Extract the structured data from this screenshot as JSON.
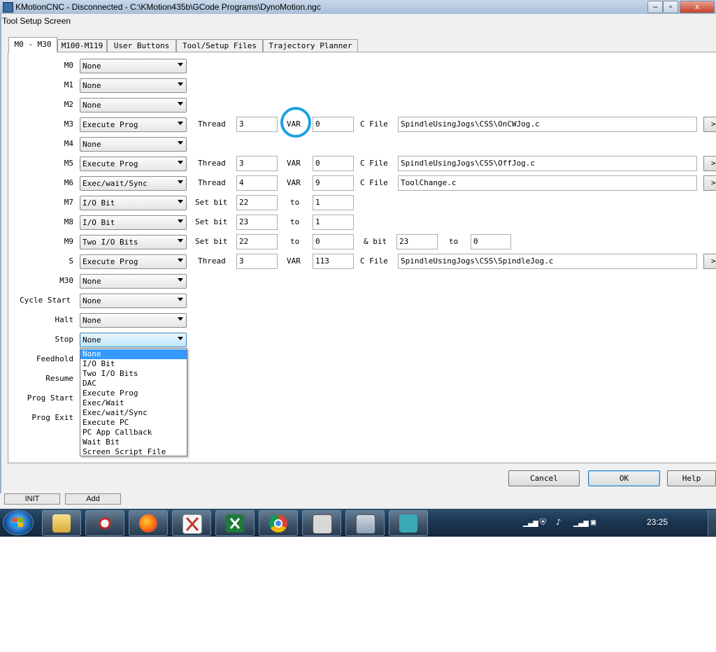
{
  "app_window": {
    "title": "KMotionCNC - Disconnected - C:\\KMotion435b\\GCode Programs\\DynoMotion.ngc",
    "minimize_label": "–",
    "restore_label": "▫",
    "close_label": "x"
  },
  "dialog": {
    "title": "Tool Setup Screen",
    "tabs": [
      {
        "label": "M0 - M30",
        "active": true
      },
      {
        "label": "M100-M119"
      },
      {
        "label": "User Buttons"
      },
      {
        "label": "Tool/Setup Files"
      },
      {
        "label": "Trajectory Planner"
      }
    ],
    "rows": [
      {
        "label": "M0",
        "action": "None"
      },
      {
        "label": "M1",
        "action": "None"
      },
      {
        "label": "M2",
        "action": "None"
      },
      {
        "label": "M3",
        "action": "Execute Prog",
        "p1_label": "Thread",
        "p1": "3",
        "p2_label": "VAR",
        "p2": "0",
        "p3_label": "C File",
        "p3": "SpindleUsingJogs\\CSS\\OnCWJog.c"
      },
      {
        "label": "M4",
        "action": "None"
      },
      {
        "label": "M5",
        "action": "Execute Prog",
        "p1_label": "Thread",
        "p1": "3",
        "p2_label": "VAR",
        "p2": "0",
        "p3_label": "C File",
        "p3": "SpindleUsingJogs\\CSS\\OffJog.c"
      },
      {
        "label": "M6",
        "action": "Exec/wait/Sync",
        "p1_label": "Thread",
        "p1": "4",
        "p2_label": "VAR",
        "p2": "9",
        "p3_label": "C File",
        "p3": "ToolChange.c"
      },
      {
        "label": "M7",
        "action": "I/O Bit",
        "p1_label": "Set bit",
        "p1": "22",
        "p2_label": "to",
        "p2": "1"
      },
      {
        "label": "M8",
        "action": "I/O Bit",
        "p1_label": "Set bit",
        "p1": "23",
        "p2_label": "to",
        "p2": "1"
      },
      {
        "label": "M9",
        "action": "Two I/O Bits",
        "p1_label": "Set bit",
        "p1": "22",
        "p2_label": "to",
        "p2": "0",
        "p3_label": "& bit",
        "p3": "23",
        "p4_label": "to",
        "p4": "0"
      },
      {
        "label": "S",
        "action": "Execute Prog",
        "p1_label": "Thread",
        "p1": "3",
        "p2_label": "VAR",
        "p2": "113",
        "p3_label": "C File",
        "p3": "SpindleUsingJogs\\CSS\\SpindleJog.c"
      },
      {
        "label": "M30",
        "action": "None"
      },
      {
        "label": "Cycle Start",
        "action": "None"
      },
      {
        "label": "Halt",
        "action": "None"
      },
      {
        "label": "Stop",
        "action": "None"
      },
      {
        "label": "Feedhold"
      },
      {
        "label": "Resume"
      },
      {
        "label": "Prog Start"
      },
      {
        "label": "Prog Exit"
      }
    ],
    "browse_label": ">",
    "dropdown_options": [
      "None",
      "I/O Bit",
      "Two I/O Bits",
      "DAC",
      "Execute Prog",
      "Exec/Wait",
      "Exec/wait/Sync",
      "Execute PC",
      "PC App Callback",
      "Wait Bit",
      "Screen Script File"
    ],
    "dropdown_selected": "None",
    "buttons": {
      "cancel": "Cancel",
      "ok": "OK",
      "help": "Help"
    }
  },
  "background_buttons": [
    "INIT",
    "Add"
  ],
  "taskbar": {
    "clock": "23:25",
    "pinned": [
      "file-explorer-icon",
      "snipping-tool-icon",
      "firefox-icon",
      "xournal-icon",
      "excel-icon",
      "chrome-icon",
      "kmotion-icon",
      "calculator-icon",
      "kmotioncnc-icon"
    ]
  },
  "colors": {
    "selection": "#3399ff",
    "highlight_circle": "#1ea0e0",
    "taskbar": "#1b3550"
  }
}
